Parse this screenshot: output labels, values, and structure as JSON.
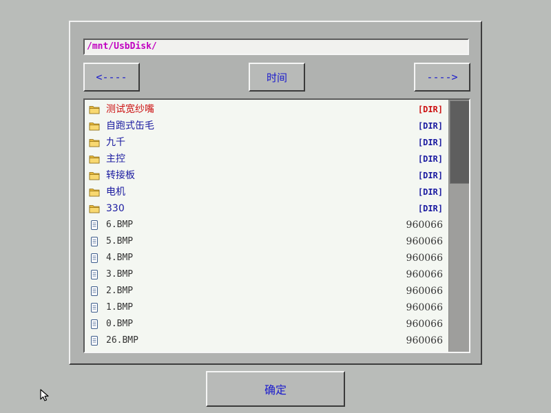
{
  "path": "/mnt/UsbDisk/",
  "nav": {
    "prev_label": "<----",
    "sort_label": "时间",
    "next_label": "---->"
  },
  "entries": [
    {
      "name": "测试宽纱嘴",
      "info": "[DIR]",
      "type": "dir",
      "selected": true
    },
    {
      "name": "自跑式缶毛",
      "info": "[DIR]",
      "type": "dir",
      "selected": false
    },
    {
      "name": "九千",
      "info": "[DIR]",
      "type": "dir",
      "selected": false
    },
    {
      "name": "主控",
      "info": "[DIR]",
      "type": "dir",
      "selected": false
    },
    {
      "name": "转接板",
      "info": "[DIR]",
      "type": "dir",
      "selected": false
    },
    {
      "name": "电机",
      "info": "[DIR]",
      "type": "dir",
      "selected": false
    },
    {
      "name": "330",
      "info": "[DIR]",
      "type": "dir",
      "selected": false
    },
    {
      "name": "6.BMP",
      "info": "960066",
      "type": "file",
      "selected": false
    },
    {
      "name": "5.BMP",
      "info": "960066",
      "type": "file",
      "selected": false
    },
    {
      "name": "4.BMP",
      "info": "960066",
      "type": "file",
      "selected": false
    },
    {
      "name": "3.BMP",
      "info": "960066",
      "type": "file",
      "selected": false
    },
    {
      "name": "2.BMP",
      "info": "960066",
      "type": "file",
      "selected": false
    },
    {
      "name": "1.BMP",
      "info": "960066",
      "type": "file",
      "selected": false
    },
    {
      "name": "0.BMP",
      "info": "960066",
      "type": "file",
      "selected": false
    },
    {
      "name": "26.BMP",
      "info": "960066",
      "type": "file",
      "selected": false
    }
  ],
  "ok_label": "确定",
  "colors": {
    "background": "#b9bcb9",
    "selected_text": "#cc1010",
    "dir_text": "#1a1aa0",
    "path_text": "#c000c0"
  },
  "icons": {
    "dir": "folder-icon",
    "file": "file-icon",
    "pointer": "mouse-pointer-icon"
  }
}
